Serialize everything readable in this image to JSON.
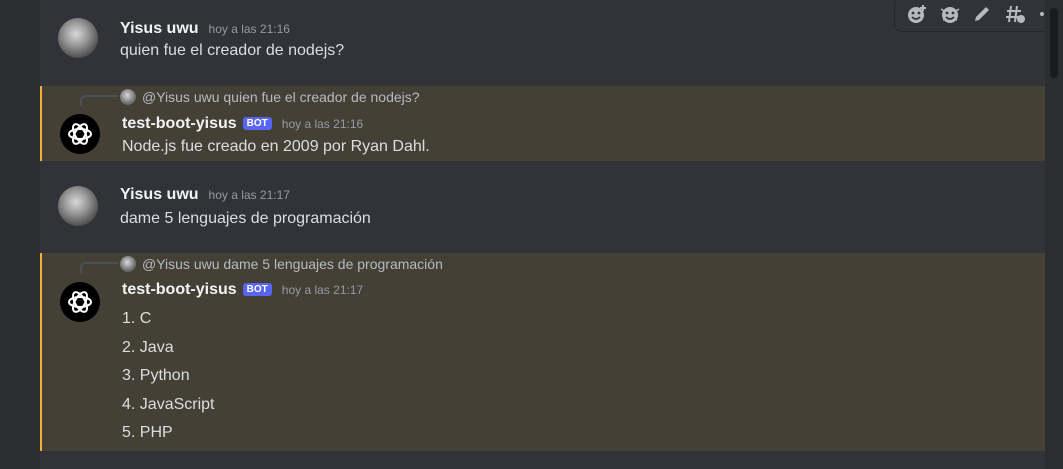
{
  "messages": [
    {
      "username": "Yisus uwu",
      "timestamp": "hoy a las 21:16",
      "content": "quien fue el creador de nodejs?"
    },
    {
      "reply": "@Yisus uwu quien fue el creador de nodejs?",
      "username": "test-boot-yisus",
      "bot_tag": "BOT",
      "timestamp": "hoy a las 21:16",
      "content": "Node.js fue creado en 2009 por Ryan Dahl."
    },
    {
      "username": "Yisus uwu",
      "timestamp": "hoy a las 21:17",
      "content": "dame 5 lenguajes de programación"
    },
    {
      "reply": "@Yisus uwu dame 5 lenguajes de programación",
      "username": "test-boot-yisus",
      "bot_tag": "BOT",
      "timestamp": "hoy a las 21:17",
      "lines": [
        "1. C",
        "2. Java",
        "3. Python",
        "4. JavaScript",
        "5. PHP"
      ]
    }
  ],
  "toolbar": {
    "icons": [
      "add-reaction-icon",
      "super-reaction-icon",
      "edit-icon",
      "create-thread-icon",
      "more-options-icon"
    ]
  },
  "colors": {
    "background": "#313338",
    "mention_highlight": "#444036",
    "mention_border": "#f0b232",
    "bot_tag": "#5865f2"
  }
}
